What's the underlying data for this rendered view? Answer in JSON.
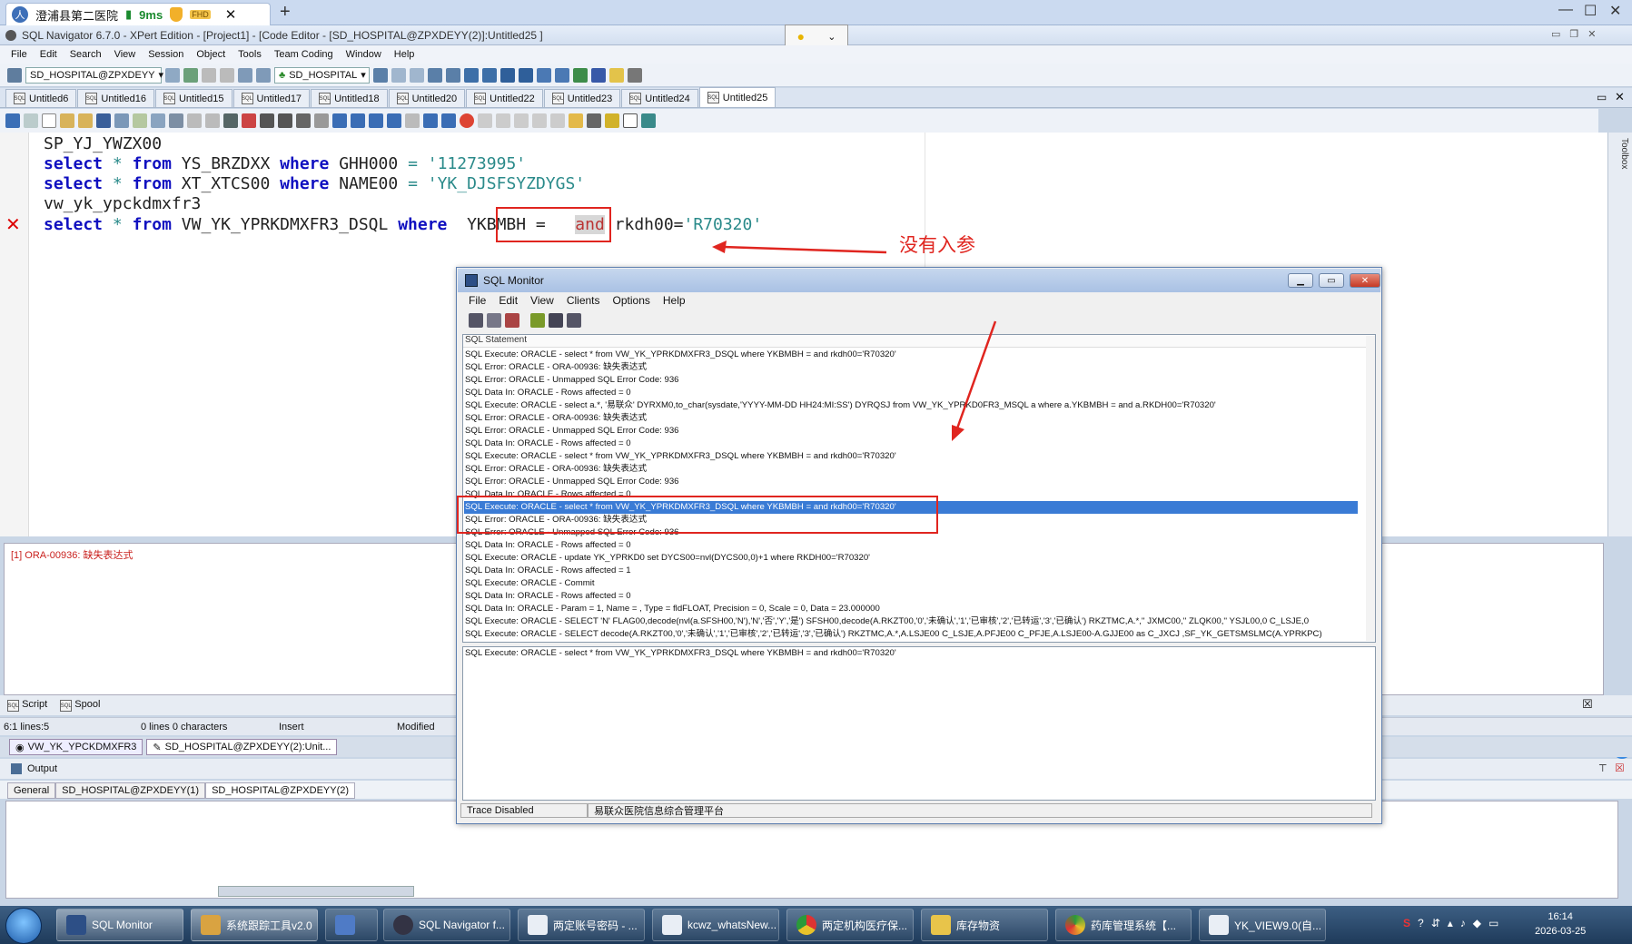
{
  "browser": {
    "tab_title": "澄浦县第二医院",
    "latency": "9ms",
    "badge": "FHD"
  },
  "window": {
    "title": "SQL Navigator 6.7.0 - XPert Edition - [Project1] - [Code Editor - [SD_HOSPITAL@ZPXDEYY(2)]:Untitled25 ]"
  },
  "menu": [
    "File",
    "Edit",
    "Search",
    "View",
    "Session",
    "Object",
    "Tools",
    "Team Coding",
    "Window",
    "Help"
  ],
  "toolbar": {
    "connection_combo": "SD_HOSPITAL@ZPXDEYY",
    "schema_combo": "SD_HOSPITAL"
  },
  "doc_tabs": [
    "Untitled6",
    "Untitled16",
    "Untitled15",
    "Untitled17",
    "Untitled18",
    "Untitled20",
    "Untitled22",
    "Untitled23",
    "Untitled24",
    "Untitled25"
  ],
  "editor": {
    "line1": "SP_YJ_YWZX00",
    "line2": {
      "kw1": "select",
      "star": "*",
      "kw2": "from",
      "table": "YS_BRZDXX",
      "kw3": "where",
      "col": "GHH000",
      "eq": "=",
      "val": "'11273995'"
    },
    "line3": {
      "kw1": "select",
      "star": "*",
      "kw2": "from",
      "table": "XT_XTCS00",
      "kw3": "where",
      "col": "NAME00",
      "eq": "=",
      "val": "'YK_DJSFSYZDYGS'"
    },
    "line4": "vw_yk_ypckdmxfr3",
    "line5": {
      "kw1": "select",
      "star": "*",
      "kw2": "from",
      "table": "VW_YK_YPRKDMXFR3_DSQL",
      "kw3": "where",
      "boxed": "YKBMBH =",
      "and": "and",
      "rest": "rkdh00=",
      "val": "'R70320'"
    },
    "annotation": "没有入参"
  },
  "toolbox_label": "Toolbox",
  "message": "[1] ORA-00936: 缺失表达式",
  "script_tabs": [
    "Script",
    "Spool"
  ],
  "status": {
    "position": "6:1 lines:5",
    "selection": "0 lines 0 characters",
    "mode": "Insert",
    "state": "Modified"
  },
  "conn_tabs": [
    "VW_YK_YPCKDMXFR3",
    "SD_HOSPITAL@ZPXDEYY(2):Unit..."
  ],
  "output": {
    "title": "Output",
    "tabs": [
      "General",
      "SD_HOSPITAL@ZPXDEYY(1)",
      "SD_HOSPITAL@ZPXDEYY(2)"
    ]
  },
  "monitor": {
    "title": "SQL Monitor",
    "menu": [
      "File",
      "Edit",
      "View",
      "Clients",
      "Options",
      "Help"
    ],
    "column_header": "SQL Statement",
    "rows": [
      "SQL Execute: ORACLE - select * from VW_YK_YPRKDMXFR3_DSQL where YKBMBH =  and rkdh00='R70320'",
      "SQL Error: ORACLE - ORA-00936: 缺失表达式",
      "SQL Error: ORACLE - Unmapped SQL Error Code: 936",
      "SQL Data In: ORACLE - Rows affected = 0",
      "SQL Execute: ORACLE - select a.*, '易联众' DYRXM0,to_char(sysdate,'YYYY-MM-DD HH24:MI:SS') DYRQSJ from VW_YK_YPRKD0FR3_MSQL a where a.YKBMBH =  and a.RKDH00='R70320'",
      "SQL Error: ORACLE - ORA-00936: 缺失表达式",
      "SQL Error: ORACLE - Unmapped SQL Error Code: 936",
      "SQL Data In: ORACLE - Rows affected = 0",
      "SQL Execute: ORACLE - select * from VW_YK_YPRKDMXFR3_DSQL where YKBMBH =  and rkdh00='R70320'",
      "SQL Error: ORACLE - ORA-00936: 缺失表达式",
      "SQL Error: ORACLE - Unmapped SQL Error Code: 936",
      "SQL Data In: ORACLE - Rows affected = 0",
      "SQL Execute: ORACLE - select * from VW_YK_YPRKDMXFR3_DSQL where YKBMBH =  and rkdh00='R70320'",
      "SQL Error: ORACLE - ORA-00936: 缺失表达式",
      "SQL Error: ORACLE - Unmapped SQL Error Code: 936",
      "SQL Data In: ORACLE - Rows affected = 0",
      "SQL Execute: ORACLE - update YK_YPRKD0 set DYCS00=nvl(DYCS00,0)+1 where RKDH00='R70320'",
      "SQL Data In: ORACLE - Rows affected = 1",
      "SQL Execute: ORACLE - Commit",
      "SQL Data In: ORACLE - Rows affected = 0",
      "SQL Data In: ORACLE - Param = 1, Name = , Type = fldFLOAT, Precision = 0, Scale = 0, Data = 23.000000",
      "SQL Execute: ORACLE - SELECT 'N' FLAG00,decode(nvl(a.SFSH00,'N'),'N','否','Y','是') SFSH00,decode(A.RKZT00,'0','未确认','1','已审核','2','已转运','3','已确认') RKZTMC,A.*,'' JXMC00,'' ZLQK00,'' YSJL00,0 C_LSJE,0",
      "SQL Execute: ORACLE - SELECT decode(A.RKZT00,'0','未确认','1','已审核','2','已转运','3','已确认') RKZTMC,A.*,A.LSJE00 C_LSJE,A.PFJE00 C_PFJE,A.LSJE00-A.GJJE00 as C_JXCJ ,SF_YK_GETSMSLMC(A.YPRKPC)"
    ],
    "selected_index": 12,
    "detail": "SQL Execute: ORACLE - select * from VW_YK_YPRKDMXFR3_DSQL where YKBMBH =  and rkdh00='R70320'",
    "status_left": "Trace Disabled",
    "status_right": "易联众医院信息综合管理平台"
  },
  "taskbar": [
    "SQL Monitor",
    "系统跟踪工具v2.0",
    "",
    "SQL Navigator f...",
    "两定账号密码 - ...",
    "kcwz_whatsNew...",
    "两定机构医疗保...",
    "库存物资",
    "药库管理系统【...",
    "YK_VIEW9.0(自..."
  ],
  "clock": {
    "time": "16:14",
    "date": "2026-03-25"
  },
  "colors": {
    "accent": "#3a7bd5",
    "annotation_red": "#e0251f",
    "keyword": "#1010c0"
  }
}
